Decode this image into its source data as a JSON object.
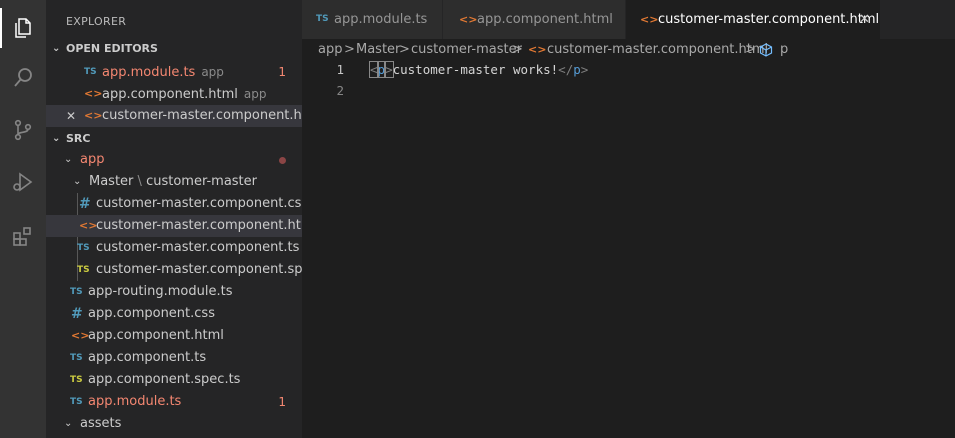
{
  "sidebar": {
    "title": "EXPLORER",
    "open_editors": {
      "header": "OPEN EDITORS",
      "items": [
        {
          "icon": "TS",
          "name": "app.module.ts",
          "hint": "app",
          "badge": "1"
        },
        {
          "icon": "<>",
          "name": "app.component.html",
          "hint": "app"
        },
        {
          "icon": "<>",
          "name": "customer-master.component.ht...",
          "close": "✕"
        }
      ]
    },
    "src": {
      "header": "SRC",
      "app_folder": "app",
      "master_folder": "Master",
      "master_sep": "\\",
      "sub_folder": "customer-master",
      "files": [
        {
          "icon": "#",
          "name": "customer-master.component.css"
        },
        {
          "icon": "<>",
          "name": "customer-master.component.html"
        },
        {
          "icon": "TS",
          "name": "customer-master.component.ts"
        },
        {
          "icon": "TS",
          "name": "customer-master.component.spec..."
        }
      ],
      "app_files": [
        {
          "icon": "TS",
          "name": "app-routing.module.ts"
        },
        {
          "icon": "#",
          "name": "app.component.css"
        },
        {
          "icon": "<>",
          "name": "app.component.html"
        },
        {
          "icon": "TS",
          "name": "app.component.ts"
        },
        {
          "icon": "TS",
          "name": "app.component.spec.ts"
        },
        {
          "icon": "TS",
          "name": "app.module.ts",
          "badge": "1"
        }
      ],
      "assets_folder": "assets"
    }
  },
  "tabs": [
    {
      "icon": "TS",
      "label": "app.module.ts"
    },
    {
      "icon": "<>",
      "label": "app.component.html"
    },
    {
      "icon": "<>",
      "label": "customer-master.component.html",
      "close": "✕"
    }
  ],
  "breadcrumbs": {
    "parts": [
      "app",
      "Master",
      "customer-master"
    ],
    "file_icon": "<>",
    "file": "customer-master.component.html",
    "symbol": "p",
    "sep": ">"
  },
  "editor": {
    "line_numbers": [
      "1",
      "2"
    ],
    "line1": {
      "open_lt": "<",
      "open_tag": "p",
      "open_gt": ">",
      "text": "customer-master works!",
      "close_lt": "</",
      "close_tag": "p",
      "close_gt": ">"
    }
  },
  "colors": {
    "ts": "#519aba",
    "spec": "#cbcb41",
    "html": "#e37933",
    "error": "#f48771",
    "tag": "#569cd6"
  }
}
